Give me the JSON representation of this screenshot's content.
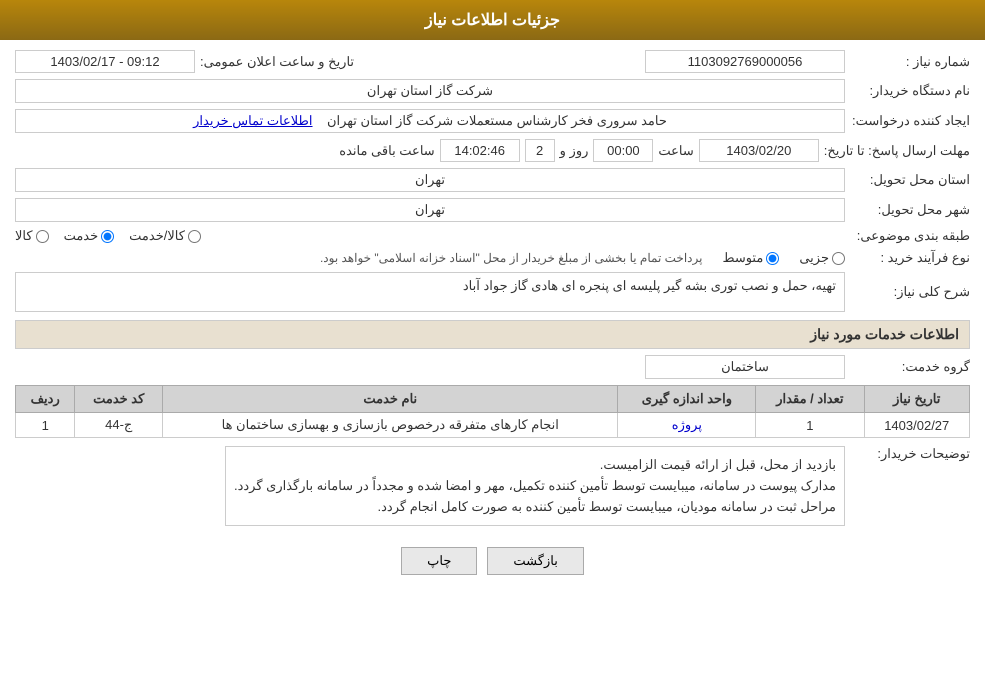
{
  "header": {
    "title": "جزئیات اطلاعات نیاز"
  },
  "fields": {
    "shomara_niaz_label": "شماره نیاز :",
    "shomara_niaz_value": "1103092769000056",
    "nam_dastgah_label": "نام دستگاه خریدار:",
    "nam_dastgah_value": "شرکت گاز استان تهران",
    "tarikho_saat_label": "تاریخ و ساعت اعلان عمومی:",
    "tarikho_saat_value": "1403/02/17 - 09:12",
    "ijad_konande_label": "ایجاد کننده درخواست:",
    "ijad_konande_value": "حامد سروری فخر کارشناس مستعملات شرکت گاز استان تهران",
    "etelaat_tamas_label": "اطلاعات تماس خریدار",
    "mohlat_label": "مهلت ارسال پاسخ: تا تاریخ:",
    "mohlat_date": "1403/02/20",
    "mohlat_saat_label": "ساعت",
    "mohlat_saat_value": "00:00",
    "mohlat_roz_label": "روز و",
    "mohlat_roz_value": "2",
    "mohlat_baghimande_label": "ساعت باقی مانده",
    "mohlat_baghimande_value": "14:02:46",
    "ostan_tahvil_label": "استان محل تحویل:",
    "ostan_tahvil_value": "تهران",
    "shahr_tahvil_label": "شهر محل تحویل:",
    "shahr_tahvil_value": "تهران",
    "tabaghebandi_label": "طبقه بندی موضوعی:",
    "tabaghebandi_options": [
      {
        "label": "کالا",
        "value": "kala",
        "checked": false
      },
      {
        "label": "خدمت",
        "value": "khadamat",
        "checked": true
      },
      {
        "label": "کالا/خدمت",
        "value": "kala_khadamat",
        "checked": false
      }
    ],
    "feraiand_label": "نوع فرآیند خرید :",
    "feraiand_options": [
      {
        "label": "جزیی",
        "value": "jozi",
        "checked": false
      },
      {
        "label": "متوسط",
        "value": "motavasset",
        "checked": true
      }
    ],
    "feraiand_note": "پرداخت تمام یا بخشی از مبلغ خریدار از محل \"اسناد خزانه اسلامی\" خواهد بود.",
    "sharh_label": "شرح کلی نیاز:",
    "sharh_value": "تهیه، حمل و نصب توری بشه گیر پلیسه ای پنجره ای هادی گاز جواد آباد",
    "khadamat_section_title": "اطلاعات خدمات مورد نیاز",
    "gerooh_khadamat_label": "گروه خدمت:",
    "gerooh_khadamat_value": "ساختمان",
    "table": {
      "headers": [
        "ردیف",
        "کد خدمت",
        "نام خدمت",
        "واحد اندازه گیری",
        "تعداد / مقدار",
        "تاریخ نیاز"
      ],
      "rows": [
        {
          "radif": "1",
          "kod": "ج-44",
          "nam": "انجام کارهای متفرقه درخصوص بازسازی و بهسازی ساختمان ها",
          "vahed": "پروژه",
          "tedad": "1",
          "tarikh": "1403/02/27"
        }
      ]
    },
    "toseeh_label": "توضیحات خریدار:",
    "toseeh_lines": [
      "بازدید از محل، قبل از ارائه قیمت الزامیست.",
      "مدارک پیوست در سامانه، میبایست توسط تأمین کننده تکمیل، مهر و امضا شده و مجدداً در سامانه بارگذاری گردد.",
      "مراحل ثبت در سامانه مودیان، میبایست توسط تأمین کننده به صورت کامل انجام گردد."
    ]
  },
  "buttons": {
    "print_label": "چاپ",
    "back_label": "بازگشت"
  }
}
